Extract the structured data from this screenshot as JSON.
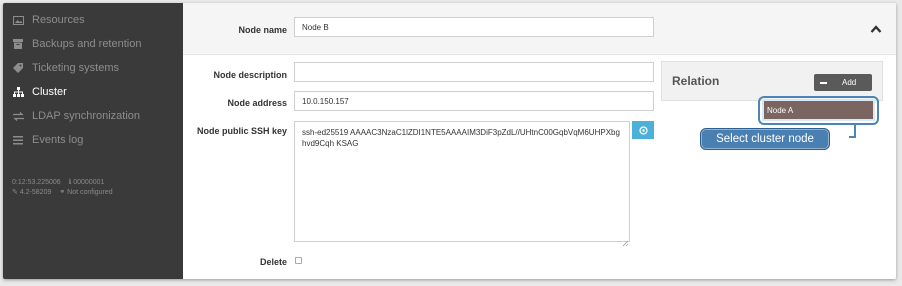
{
  "sidebar": {
    "items": [
      {
        "label": "Resources",
        "icon": "image-icon",
        "active": false
      },
      {
        "label": "Backups and retention",
        "icon": "archive-icon",
        "active": false
      },
      {
        "label": "Ticketing systems",
        "icon": "tag-icon",
        "active": false
      },
      {
        "label": "Cluster",
        "icon": "sitemap-icon",
        "active": true
      },
      {
        "label": "LDAP synchronization",
        "icon": "exchange-icon",
        "active": false
      },
      {
        "label": "Events log",
        "icon": "list-icon",
        "active": false
      }
    ],
    "footer": {
      "time": "0:12:53.225006",
      "id": "00000001",
      "version": "4.2-58209",
      "cluster_status": "Not configured"
    }
  },
  "form": {
    "node_name_label": "Node name",
    "node_name_value": "Node B",
    "node_description_label": "Node description",
    "node_description_value": "",
    "node_address_label": "Node address",
    "node_address_value": "10.0.150.157",
    "ssh_key_label": "Node public SSH key",
    "ssh_key_value": "ssh-ed25519 AAAAC3NzaC1lZDI1NTE5AAAAIM3DiF3pZdL//UHtnC00GqbVqM6UHPXbghvd9Cqh KSAG",
    "delete_label": "Delete"
  },
  "relation": {
    "title": "Relation",
    "add_label": "Add",
    "option": "Node A"
  },
  "callout": {
    "text": "Select cluster node"
  },
  "colors": {
    "sidebar_bg": "#3a3a3a",
    "accent": "#4bb1d8",
    "callout_bg": "#4a7fb2",
    "selected_option": "#7b6560"
  }
}
